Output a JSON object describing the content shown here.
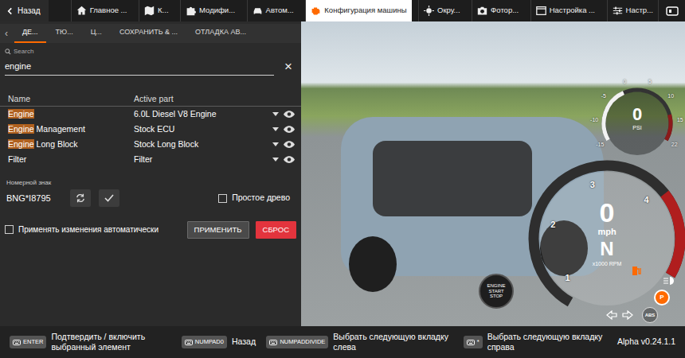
{
  "top_bar": {
    "back": "Назад",
    "tabs": [
      {
        "label": "Главное ...",
        "selected": false
      },
      {
        "label": "К...",
        "selected": false
      },
      {
        "label": "Модифи...",
        "selected": false
      },
      {
        "label": "Автом...",
        "selected": false
      },
      {
        "label": "Конфигурация машины",
        "selected": true
      },
      {
        "label": "Окру...",
        "selected": false
      },
      {
        "label": "Фотор...",
        "selected": false
      },
      {
        "label": "Настройка ...",
        "selected": false
      },
      {
        "label": "Настр...",
        "selected": false
      }
    ]
  },
  "panel": {
    "subtabs": {
      "prev": "‹",
      "items": [
        {
          "label": "ДЕ...",
          "selected": true
        },
        {
          "label": "ТЮ...",
          "selected": false
        },
        {
          "label": "Ц...",
          "selected": false
        },
        {
          "label": "СОХРАНИТЬ & ...",
          "selected": false
        },
        {
          "label": "ОТЛАДКА АВ...",
          "selected": false
        }
      ]
    },
    "search": {
      "label": "Search",
      "value": "engine",
      "clear": "×"
    },
    "table": {
      "columns": [
        "Name",
        "Active part"
      ],
      "rows": [
        {
          "name": [
            {
              "text": "Engine",
              "highlighted": true
            }
          ],
          "part": "6.0L Diesel V8 Engine"
        },
        {
          "name": [
            {
              "text": "Engine",
              "highlighted": true
            },
            {
              "text": " Management",
              "highlighted": false
            }
          ],
          "part": "Stock ECU"
        },
        {
          "name": [
            {
              "text": "Engine",
              "highlighted": true
            },
            {
              "text": " Long Block",
              "highlighted": false
            }
          ],
          "part": "Stock Long Block"
        },
        {
          "name": [
            {
              "text": "Filter",
              "highlighted": false
            }
          ],
          "part": "Filter"
        }
      ]
    },
    "plate": {
      "label": "Номерной знак",
      "value": "BNG*I8795"
    },
    "simple_tree": {
      "label": "Простое древо",
      "checked": false
    },
    "auto_apply": {
      "label": "Применять изменения автоматически",
      "checked": false
    },
    "buttons": [
      {
        "label": "ПРИМЕНИТЬ",
        "kind": "apply"
      },
      {
        "label": "СБРОС",
        "kind": "reset"
      }
    ]
  },
  "hud": {
    "boost": {
      "value": "0",
      "unit": "PSI",
      "ticks": [
        "-15",
        "-10",
        "-5",
        "0",
        "5",
        "10",
        "15",
        "22"
      ],
      "level": 0.4
    },
    "speed": {
      "value": "0",
      "unit": "mph"
    },
    "tacho": {
      "ticks": [
        "1",
        "2",
        "3",
        "4"
      ],
      "level": 0,
      "unit": "x1000 RPM",
      "gear": "N"
    },
    "indicators": [
      {
        "label": "P",
        "active": true
      },
      {
        "label": "ABS",
        "active": false
      }
    ],
    "engine_button": [
      "ENGINE",
      "START",
      "STOP"
    ]
  },
  "hints": [
    {
      "key": "ENTER",
      "text": "Подтвердить / включить выбранный элемент"
    },
    {
      "key": "NUMPAD0",
      "text": "Назад"
    },
    {
      "key": "NUMPADDIVIDE",
      "text": "Выбрать следующую вкладку слева"
    },
    {
      "key": "*",
      "text": "Выбрать следующую вкладку справа"
    }
  ],
  "version": "Alpha v0.24.1.1"
}
